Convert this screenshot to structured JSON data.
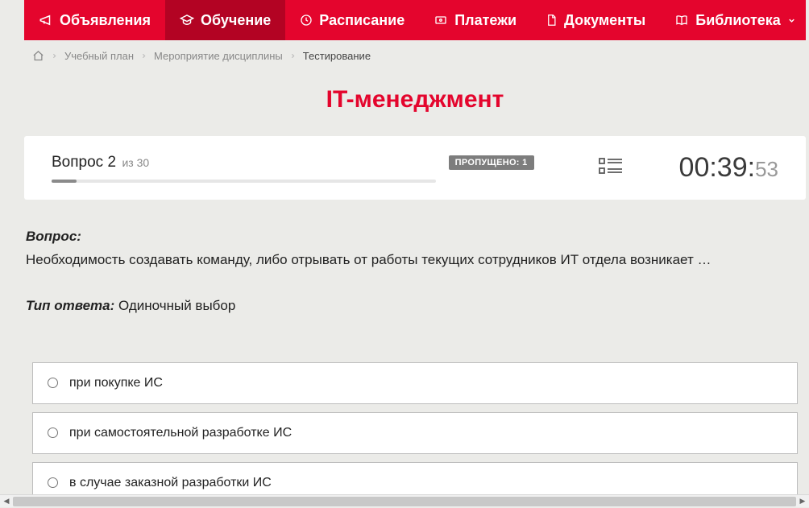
{
  "nav": {
    "items": [
      {
        "label": "Объявления",
        "icon": "megaphone"
      },
      {
        "label": "Обучение",
        "icon": "graduation",
        "active": true
      },
      {
        "label": "Расписание",
        "icon": "clock"
      },
      {
        "label": "Платежи",
        "icon": "payment"
      },
      {
        "label": "Документы",
        "icon": "document"
      },
      {
        "label": "Библиотека",
        "icon": "book",
        "dropdown": true
      }
    ]
  },
  "breadcrumb": {
    "items": [
      {
        "label": "Учебный план"
      },
      {
        "label": "Мероприятие дисциплины"
      },
      {
        "label": "Тестирование",
        "current": true
      }
    ]
  },
  "page_title": "IT-менеджмент",
  "quiz": {
    "question_word": "Вопрос",
    "question_number": "2",
    "question_of": "из 30",
    "skipped_label": "ПРОПУЩЕНО: 1",
    "timer_main": "00:39:",
    "timer_seconds": "53"
  },
  "question": {
    "label": "Вопрос:",
    "text": "Необходимость создавать команду, либо отрывать от работы текущих сотрудников ИТ отдела возникает …",
    "answer_type_label": "Тип ответа:",
    "answer_type_value": "Одиночный выбор",
    "options": [
      {
        "text": "при покупке ИС"
      },
      {
        "text": "при самостоятельной разработке ИС"
      },
      {
        "text": "в случае заказной разработки ИС"
      }
    ]
  }
}
